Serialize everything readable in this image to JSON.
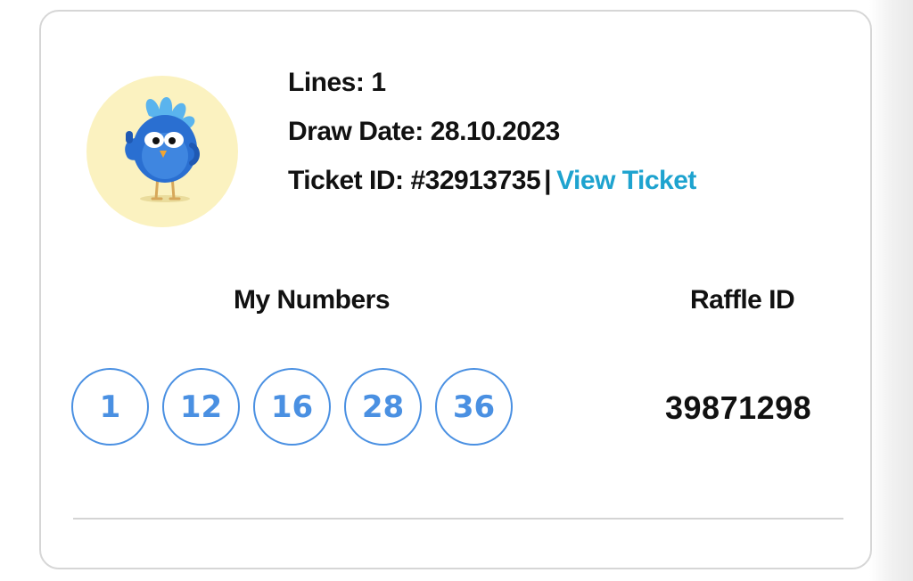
{
  "ticket": {
    "lines_label": "Lines:",
    "lines_value": "1",
    "draw_date_label": "Draw Date:",
    "draw_date_value": "28.10.2023",
    "ticket_id_label": "Ticket ID:",
    "ticket_id_value": "#32913735",
    "separator": "|",
    "view_ticket_label": "View Ticket"
  },
  "numbers_section": {
    "label": "My Numbers",
    "numbers": [
      "1",
      "12",
      "16",
      "28",
      "36"
    ]
  },
  "raffle_section": {
    "label": "Raffle ID",
    "value": "39871298"
  },
  "colors": {
    "accent_link": "#1ea3cf",
    "ball_blue": "#4a90e2",
    "avatar_bg": "#fbf2c0"
  },
  "icons": {
    "avatar": "bird-mascot-thumbs-up-icon"
  }
}
